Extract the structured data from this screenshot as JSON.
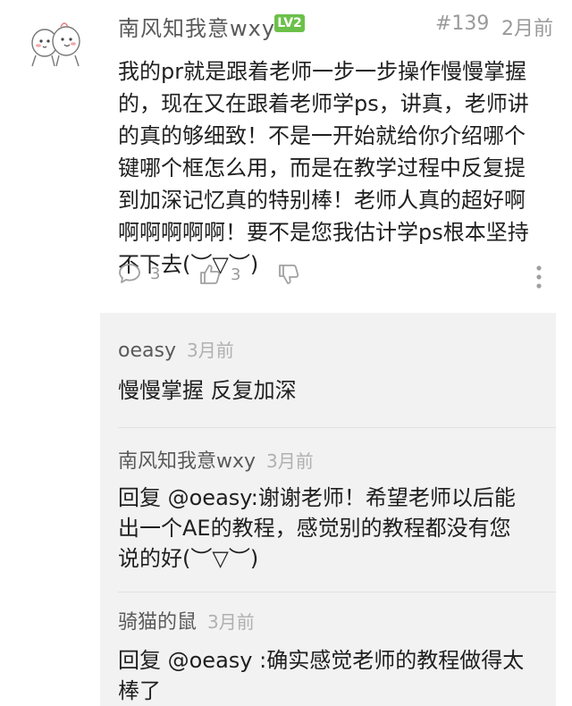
{
  "post": {
    "user_name": "南风知我意wxy",
    "level": "LV2",
    "floor": "#139",
    "time": "2月前",
    "body": "我的pr就是跟着老师一步一步操作慢慢掌握\n的，现在又在跟着老师学ps，讲真，老师讲\n的真的够细致！不是一开始就给你介绍哪个\n键哪个框怎么用，而是在教学过程中反复提\n到加深记忆真的特别棒！老师人真的超好啊\n啊啊啊啊啊！要不是您我估计学ps根本坚持\n不下去(︶▽︶)",
    "comment_count": "3",
    "like_count": "3"
  },
  "replies": [
    {
      "user": "oeasy",
      "time": "3月前",
      "body": "慢慢掌握 反复加深"
    },
    {
      "user": "南风知我意wxy",
      "time": "3月前",
      "body": "回复 @oeasy:谢谢老师！希望老师以后能\n出一个AE的教程，感觉别的教程都没有您\n说的好(︶▽︶)"
    },
    {
      "user": "骑猫的鼠",
      "time": "3月前",
      "body": "回复 @oeasy :确实感觉老师的教程做得太\n棒了"
    }
  ],
  "icons": {
    "comment": "comment-icon",
    "like": "thumbs-up-icon",
    "dislike": "thumbs-down-icon",
    "more": "more-vertical-icon",
    "avatar": "cartoon-avatar"
  },
  "colors": {
    "level_badge": "#6cc04a",
    "reply_background": "#f2f2f2"
  }
}
